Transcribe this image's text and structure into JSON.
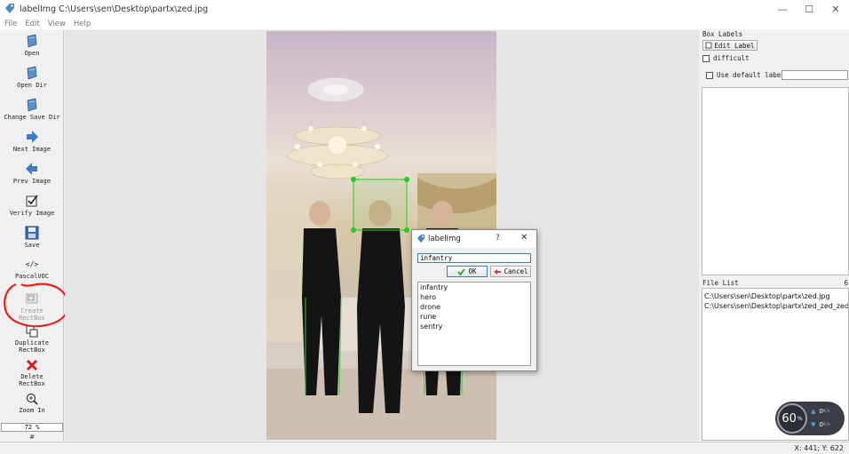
{
  "window": {
    "title": "labelImg C:\\Users\\sen\\Desktop\\partx\\zed.jpg",
    "minimize_glyph": "—",
    "maximize_glyph": "☐",
    "close_glyph": "✕"
  },
  "menu": [
    "File",
    "Edit",
    "View",
    "Help"
  ],
  "toolbar": {
    "open": "Open",
    "open_dir": "Open Dir",
    "change_save_dir": "Change Save Dir",
    "next_image": "Next Image",
    "prev_image": "Prev Image",
    "verify_image": "Verify Image",
    "save": "Save",
    "format_glyph": "</>",
    "format": "PascalVOC",
    "create_rectbox_1": "Create",
    "create_rectbox_2": "RectBox",
    "duplicate_rectbox_1": "Duplicate",
    "duplicate_rectbox_2": "RectBox",
    "delete_rectbox_1": "Delete",
    "delete_rectbox_2": "RectBox",
    "zoom_in": "Zoom In",
    "zoom_value": "72 %",
    "more": "#"
  },
  "box_labels": {
    "title": "Box Labels",
    "edit_label": "Edit Label",
    "difficult": "difficult",
    "use_default_label": "Use default label",
    "default_label_value": ""
  },
  "file_list": {
    "title": "File List",
    "title_overflow": "6",
    "files": [
      "C:\\Users\\sen\\Desktop\\partx\\zed.jpg",
      "C:\\Users\\sen\\Desktop\\partx\\zed_zed_zed.jpg"
    ]
  },
  "dialog": {
    "title": "labelImg",
    "help_glyph": "?",
    "close_glyph": "✕",
    "input_value": "infantry",
    "ok": "OK",
    "cancel": "Cancel",
    "options": [
      "infantry",
      "hero",
      "drone",
      "rune",
      "sentry"
    ]
  },
  "status": {
    "coords": "X: 441; Y: 622"
  },
  "net_widget": {
    "percent": "60",
    "percent_unit": "%",
    "upload": "0",
    "upload_unit": "K/s",
    "download": "0",
    "download_unit": "K/s"
  },
  "colors": {
    "bbox": "#22cc22",
    "annotation_circle": "#e8201a",
    "dialog_focus": "#3c7fb1"
  }
}
